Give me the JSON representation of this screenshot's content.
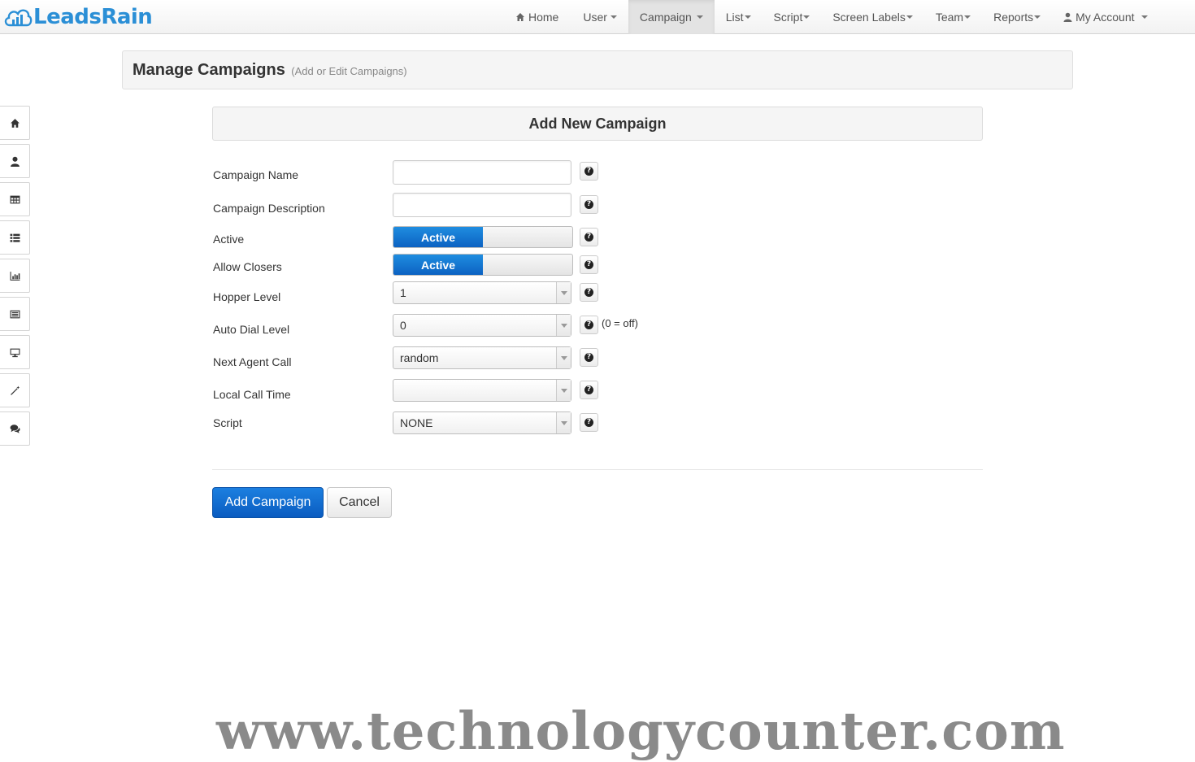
{
  "brand": {
    "name": "LeadsRain"
  },
  "nav": {
    "items": [
      {
        "label": "Home",
        "icon": "home-icon",
        "has_caret": false
      },
      {
        "label": "User",
        "has_caret": true
      },
      {
        "label": "Campaign",
        "has_caret": true,
        "active": true
      },
      {
        "label": "List",
        "has_caret": true
      },
      {
        "label": "Script",
        "has_caret": true
      },
      {
        "label": "Screen Labels",
        "has_caret": true
      },
      {
        "label": "Team",
        "has_caret": true
      },
      {
        "label": "Reports",
        "has_caret": true
      },
      {
        "label": "My Account",
        "icon": "user-icon",
        "has_caret": true
      }
    ]
  },
  "page": {
    "title": "Manage Campaigns",
    "subtitle": "(Add or Edit Campaigns)"
  },
  "sidebar": {
    "icons": [
      "home-icon",
      "user-icon",
      "table-icon",
      "list-icon",
      "bar-chart-icon",
      "list-alt-icon",
      "desktop-icon",
      "magic-wand-icon",
      "comments-icon"
    ]
  },
  "form": {
    "heading": "Add New Campaign",
    "fields": {
      "campaign_name": {
        "label": "Campaign Name",
        "value": ""
      },
      "campaign_description": {
        "label": "Campaign Description",
        "value": ""
      },
      "active": {
        "label": "Active",
        "state": "Active"
      },
      "allow_closers": {
        "label": "Allow Closers",
        "state": "Active"
      },
      "hopper_level": {
        "label": "Hopper Level",
        "value": "1"
      },
      "auto_dial_level": {
        "label": "Auto Dial Level",
        "value": "0",
        "hint": "(0 = off)"
      },
      "next_agent_call": {
        "label": "Next Agent Call",
        "value": "random"
      },
      "local_call_time": {
        "label": "Local Call Time",
        "value": ""
      },
      "script": {
        "label": "Script",
        "value": "NONE"
      }
    },
    "help_glyph": "?",
    "buttons": {
      "submit": "Add Campaign",
      "cancel": "Cancel"
    }
  },
  "colors": {
    "brand": "#2b8fd6",
    "primary": "#0c62c2"
  },
  "watermark": "www.technologycounter.com"
}
